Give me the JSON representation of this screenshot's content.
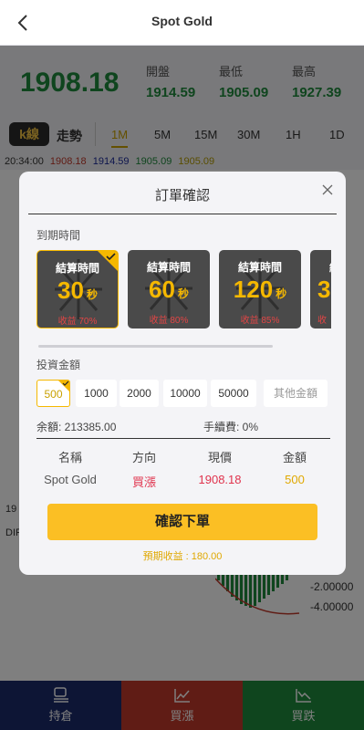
{
  "header": {
    "title": "Spot Gold"
  },
  "quote": {
    "price": "1908.18",
    "stats": [
      {
        "label": "開盤",
        "value": "1914.59"
      },
      {
        "label": "最低",
        "value": "1905.09"
      },
      {
        "label": "最高",
        "value": "1927.39"
      }
    ]
  },
  "tabs": {
    "kline": "k線",
    "trend": "走勢",
    "timeframes": [
      "1M",
      "5M",
      "15M",
      "30M",
      "1H",
      "1D"
    ],
    "active_timeframe": "1M"
  },
  "ohlc_row": {
    "time": "20:34:00",
    "values": [
      "1908.18",
      "1914.59",
      "1905.09",
      "1905.09"
    ]
  },
  "chart_side": {
    "left_value": "19",
    "left_label": "DIF"
  },
  "axis_labels": [
    "-2.00000",
    "-4.00000"
  ],
  "modal": {
    "title": "訂單確認",
    "expiry_label": "到期時間",
    "cards": [
      {
        "title": "結算時間",
        "value": "30",
        "unit": "秒",
        "ret": "收益 70%",
        "selected": true
      },
      {
        "title": "結算時間",
        "value": "60",
        "unit": "秒",
        "ret": "收益 80%",
        "selected": false
      },
      {
        "title": "結算時間",
        "value": "120",
        "unit": "秒",
        "ret": "收益 85%",
        "selected": false
      },
      {
        "title": "結算時間",
        "value": "3",
        "unit": "",
        "ret": "收",
        "selected": false
      }
    ],
    "amount_label": "投資金額",
    "amounts": [
      "500",
      "1000",
      "2000",
      "10000",
      "50000"
    ],
    "selected_amount": "500",
    "other_amount_placeholder": "其他金額",
    "balance": "余額: 213385.00",
    "fee": "手續費: 0%",
    "table_headers": [
      "名稱",
      "方向",
      "現價",
      "金額"
    ],
    "table_row": {
      "name": "Spot Gold",
      "direction": "買漲",
      "price": "1908.18",
      "amount": "500"
    },
    "confirm_label": "確認下單",
    "expected_income": "預期收益 : 180.00"
  },
  "bottom_nav": [
    {
      "label": "持倉",
      "icon": "position-icon"
    },
    {
      "label": "買漲",
      "icon": "chart-up-icon"
    },
    {
      "label": "買跌",
      "icon": "chart-down-icon"
    }
  ],
  "colors": {
    "up_green": "#1f8a3c",
    "down_red": "#c0392b",
    "accent_gold": "#fbbf24",
    "nav_blue": "#1b2a6b"
  }
}
